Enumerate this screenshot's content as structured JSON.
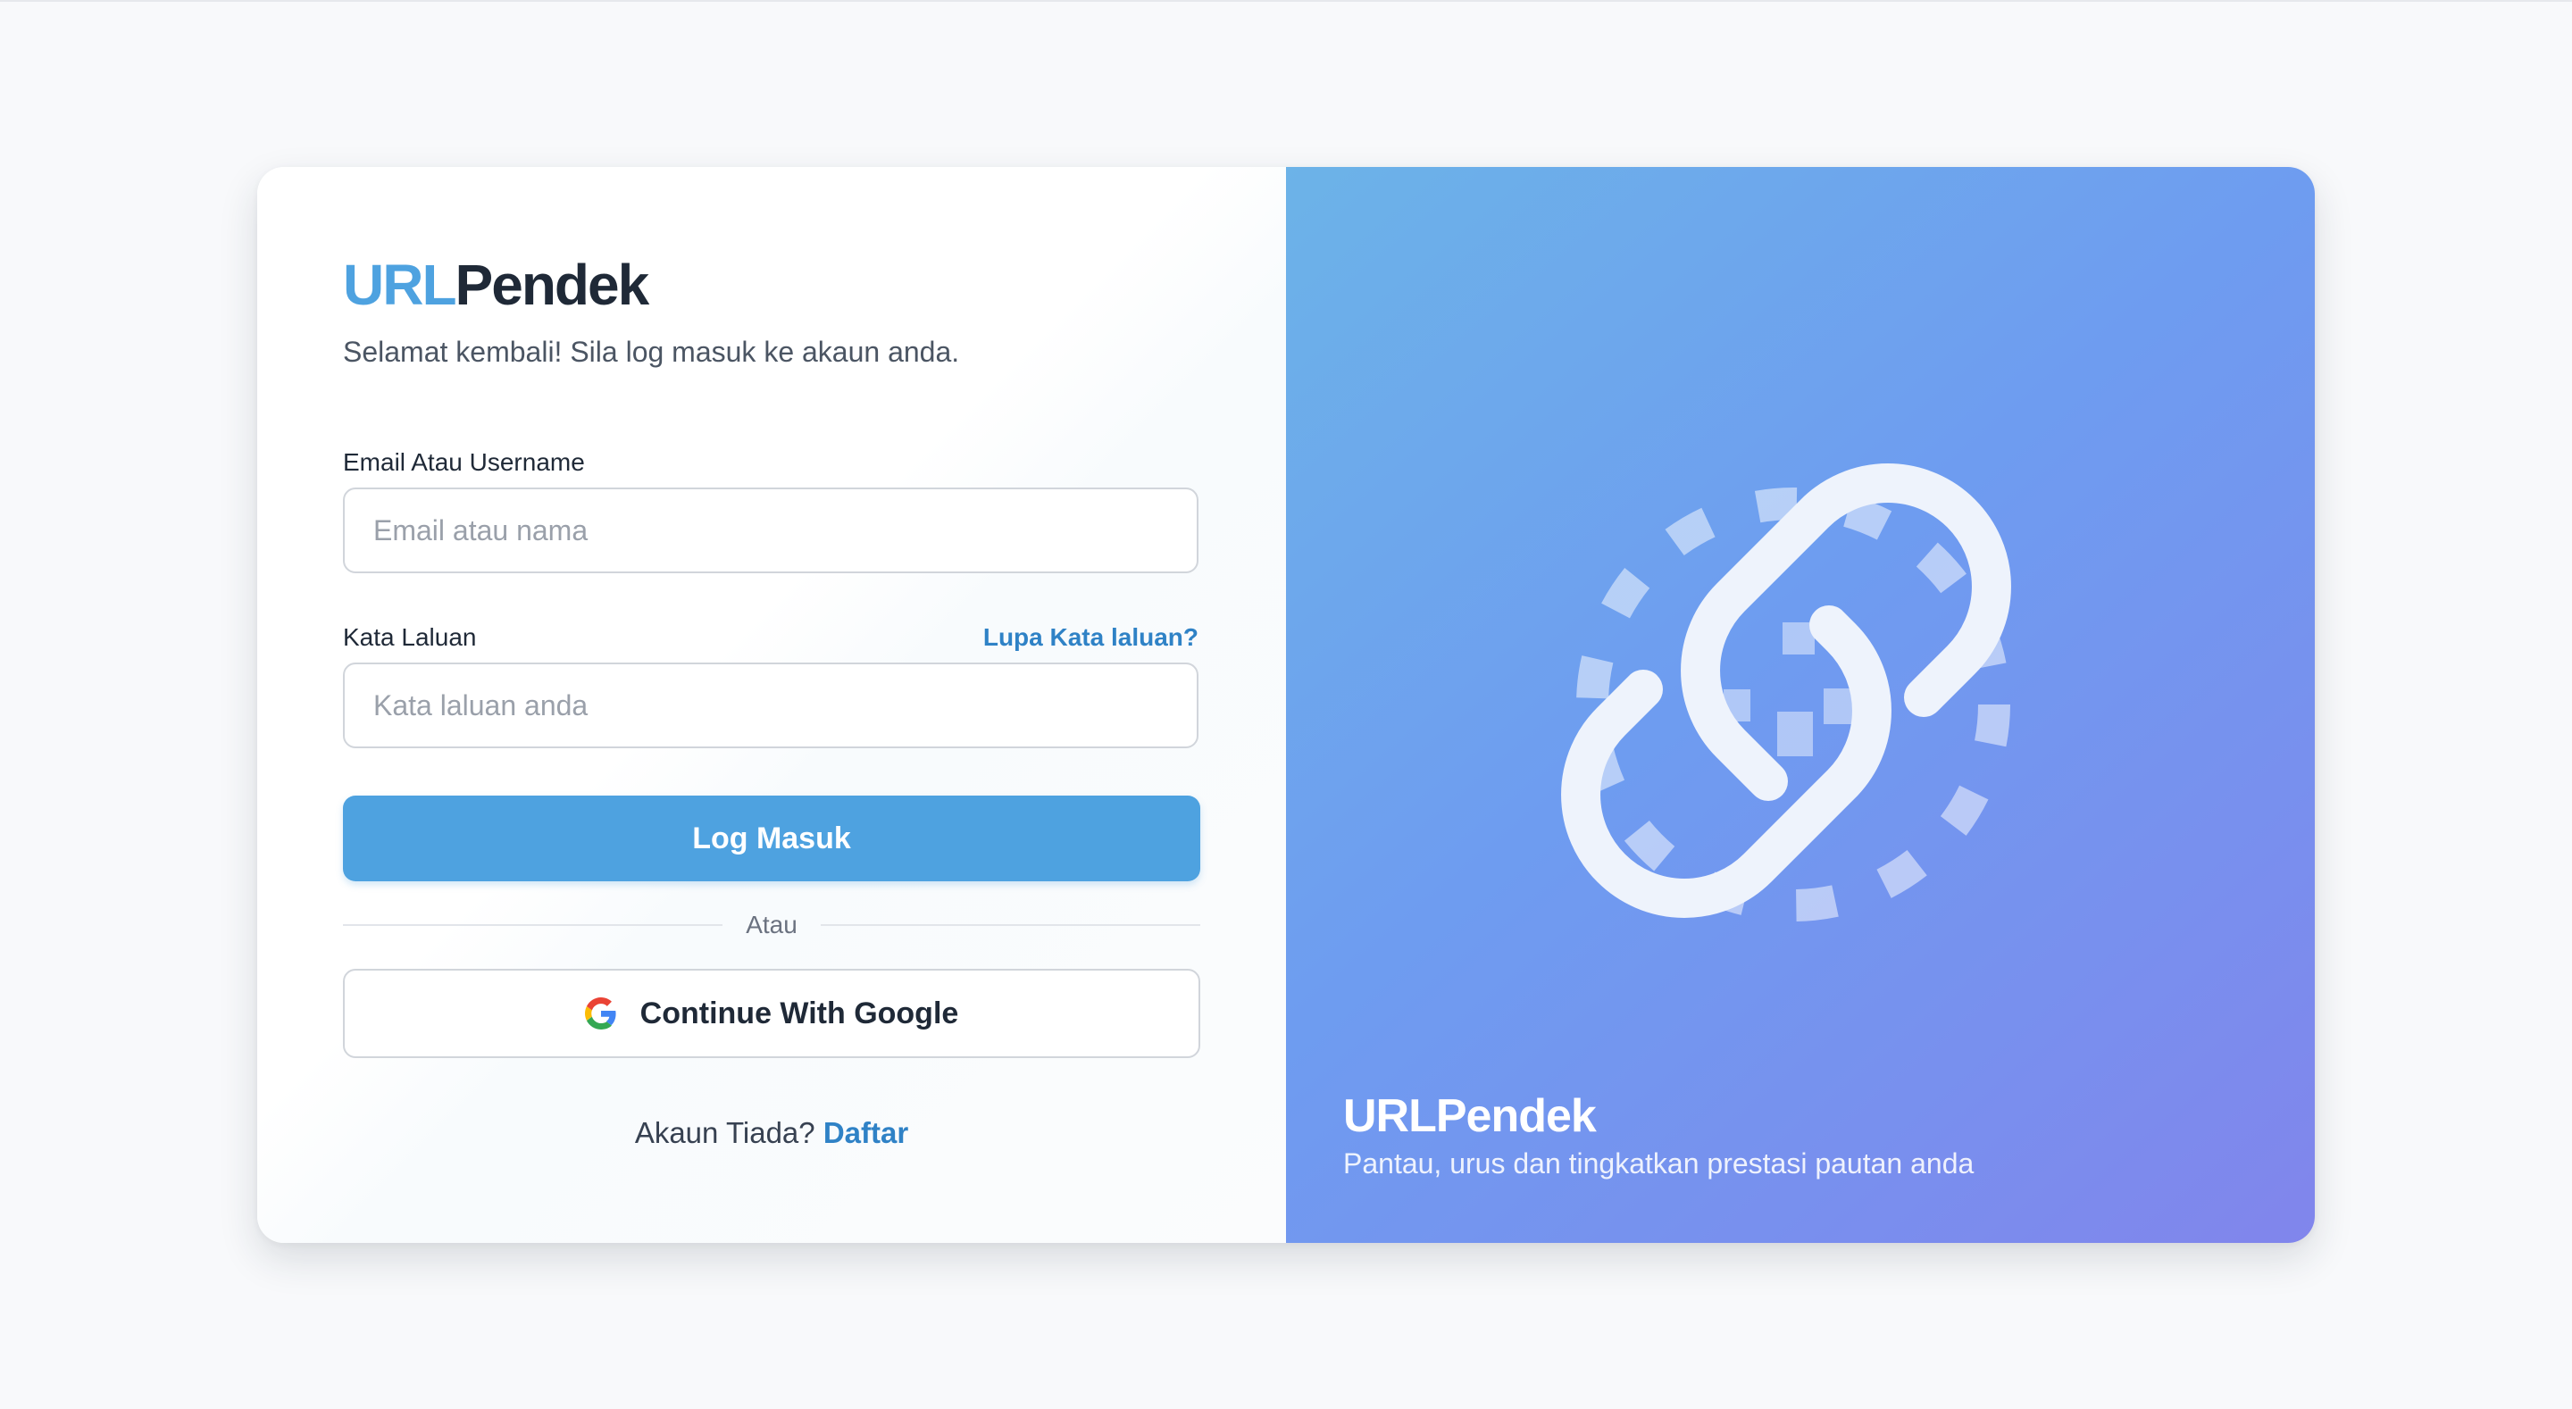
{
  "brand": {
    "name_part1": "URL",
    "name_part2": "Pendek",
    "welcome": "Selamat kembali! Sila log masuk ke akaun anda."
  },
  "form": {
    "email_label": "Email Atau Username",
    "email_placeholder": "Email atau nama",
    "email_value": "",
    "password_label": "Kata Laluan",
    "password_placeholder": "Kata laluan anda",
    "password_value": "",
    "forgot_label": "Lupa Kata laluan?",
    "login_label": "Log Masuk",
    "divider_label": "Atau",
    "google_label": "Continue With Google",
    "signup_prompt": "Akaun Tiada?",
    "signup_link": "Daftar"
  },
  "hero": {
    "title": "URLPendek",
    "subtitle": "Pantau, urus dan tingkatkan prestasi pautan anda",
    "icon": "link-chain-icon"
  },
  "colors": {
    "accent": "#4ea2e0",
    "link": "#2f82c6",
    "text_dark": "#1f2937",
    "hero_gradient_start": "#6cb3e8",
    "hero_gradient_end": "#8185ec"
  }
}
